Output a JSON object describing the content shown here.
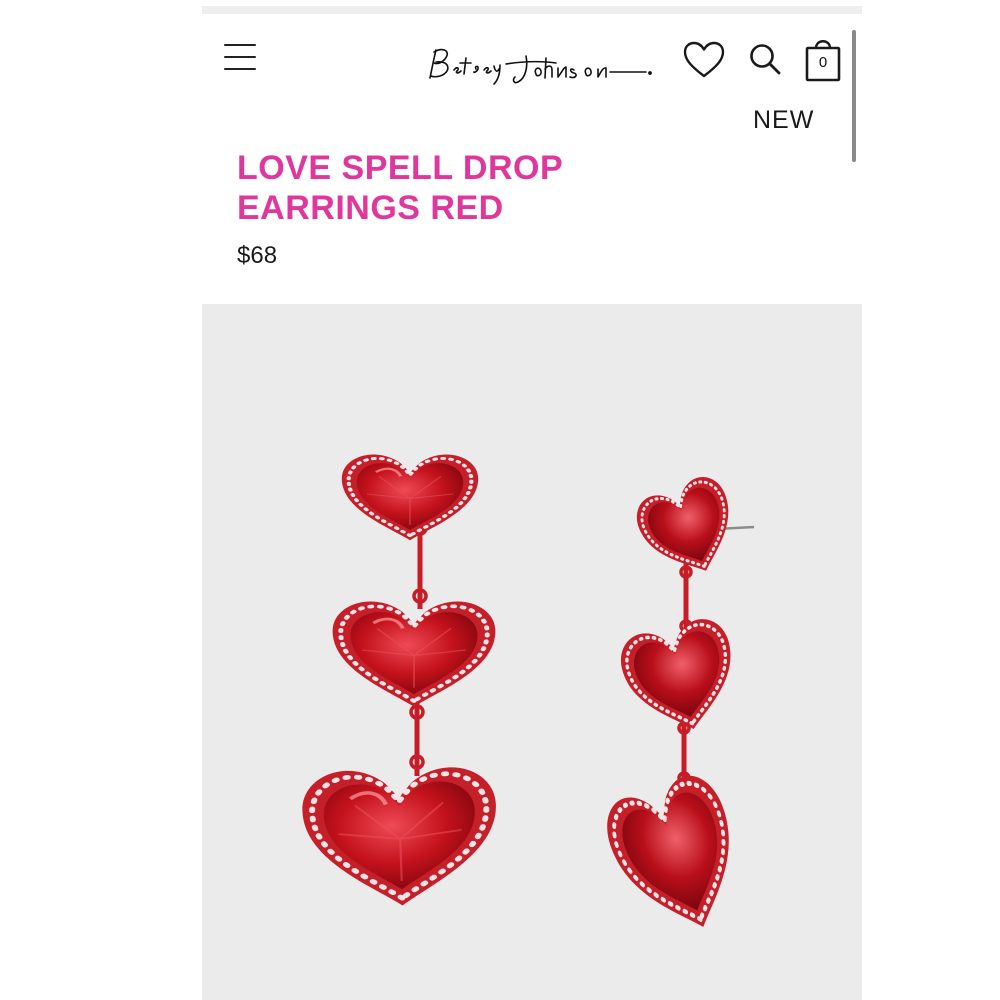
{
  "header": {
    "logo_text": "Betsey Johnson",
    "cart_count": "0"
  },
  "nav": {
    "new_label": "NEW"
  },
  "product": {
    "title": "LOVE SPELL DROP EARRINGS RED",
    "price": "$68",
    "image": {
      "subject": "red heart drop earrings with crystal trim",
      "background": "#ebebeb"
    }
  },
  "colors": {
    "title_pink": "#e0379c",
    "heart_red": "#c3121c",
    "text_dark": "#1a1a1a"
  },
  "icons": [
    "menu-icon",
    "heart-icon",
    "search-icon",
    "shopping-bag-icon"
  ]
}
